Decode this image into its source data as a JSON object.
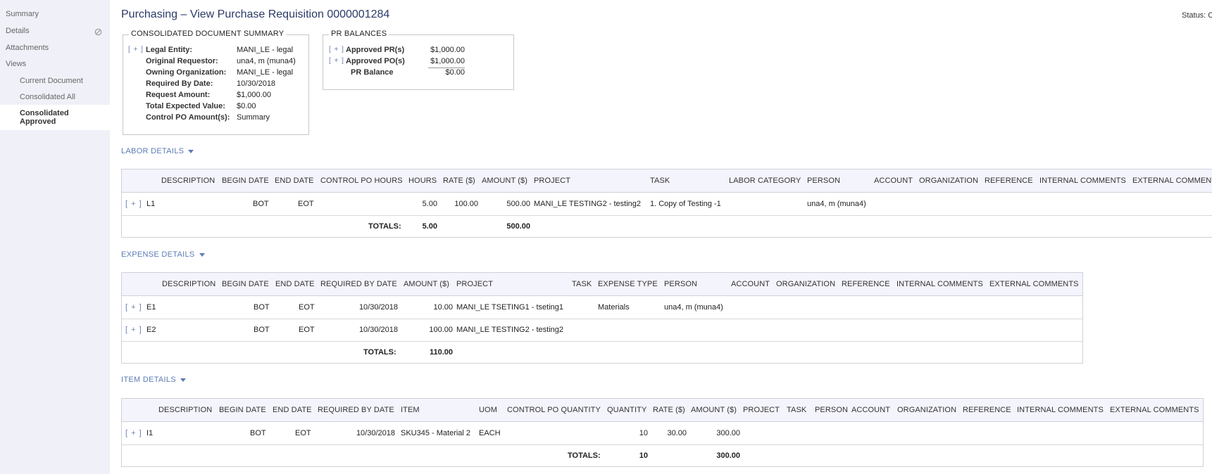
{
  "sidebar": {
    "summary": "Summary",
    "details": "Details",
    "attachments": "Attachments",
    "views": "Views",
    "current_document": "Current Document",
    "consolidated_all": "Consolidated All",
    "consolidated_approved": "Consolidated Approved"
  },
  "header": {
    "title": "Purchasing – View Purchase Requisition 0000001284",
    "status": "Status: C"
  },
  "plus": "[ + ]",
  "summary_box": {
    "legend": "CONSOLIDATED DOCUMENT SUMMARY",
    "rows": [
      {
        "label": "Legal Entity:",
        "value": "MANI_LE - legal"
      },
      {
        "label": "Original Requestor:",
        "value": "una4, m (muna4)"
      },
      {
        "label": "Owning Organization:",
        "value": "MANI_LE - legal"
      },
      {
        "label": "Required By Date:",
        "value": "10/30/2018"
      },
      {
        "label": "Request Amount:",
        "value": "$1,000.00"
      },
      {
        "label": "Total Expected Value:",
        "value": "$0.00"
      },
      {
        "label": "Control PO Amount(s):",
        "value": "Summary"
      }
    ]
  },
  "pr_balances": {
    "legend": "PR BALANCES",
    "rows": [
      {
        "label": "Approved PR(s)",
        "value": "$1,000.00"
      },
      {
        "label": "Approved PO(s)",
        "value": "$1,000.00"
      },
      {
        "label": "PR Balance",
        "value": "$0.00"
      }
    ]
  },
  "labor": {
    "title": "LABOR DETAILS",
    "headers": [
      "DESCRIPTION",
      "BEGIN DATE",
      "END DATE",
      "CONTROL PO HOURS",
      "HOURS",
      "RATE ($)",
      "AMOUNT ($)",
      "PROJECT",
      "TASK",
      "LABOR CATEGORY",
      "PERSON",
      "ACCOUNT",
      "ORGANIZATION",
      "REFERENCE",
      "INTERNAL COMMENTS",
      "EXTERNAL COMMENTS"
    ],
    "row": {
      "description": "L1",
      "begin": "BOT",
      "end": "EOT",
      "hours": "5.00",
      "rate": "100.00",
      "amount": "500.00",
      "project": "MANI_LE TESTING2 - testing2",
      "task": "1. Copy of Testing -1",
      "person": "una4, m (muna4)"
    },
    "totals": {
      "label": "TOTALS:",
      "hours": "5.00",
      "amount": "500.00"
    }
  },
  "expense": {
    "title": "EXPENSE DETAILS",
    "headers": [
      "DESCRIPTION",
      "BEGIN DATE",
      "END DATE",
      "REQUIRED BY DATE",
      "AMOUNT ($)",
      "PROJECT",
      "TASK",
      "EXPENSE TYPE",
      "PERSON",
      "ACCOUNT",
      "ORGANIZATION",
      "REFERENCE",
      "INTERNAL COMMENTS",
      "EXTERNAL COMMENTS"
    ],
    "rows": [
      {
        "description": "E1",
        "begin": "BOT",
        "end": "EOT",
        "required": "10/30/2018",
        "amount": "10.00",
        "project": "MANI_LE TSETING1 - tseting1",
        "type": "Materials",
        "person": "una4, m (muna4)"
      },
      {
        "description": "E2",
        "begin": "BOT",
        "end": "EOT",
        "required": "10/30/2018",
        "amount": "100.00",
        "project": "MANI_LE TESTING2 - testing2",
        "type": "",
        "person": ""
      }
    ],
    "totals": {
      "label": "TOTALS:",
      "amount": "110.00"
    }
  },
  "item": {
    "title": "ITEM DETAILS",
    "headers": [
      "DESCRIPTION",
      "BEGIN DATE",
      "END DATE",
      "REQUIRED BY DATE",
      "ITEM",
      "UOM",
      "CONTROL PO QUANTITY",
      "QUANTITY",
      "RATE ($)",
      "AMOUNT ($)",
      "PROJECT",
      "TASK",
      "PERSON",
      "ACCOUNT",
      "ORGANIZATION",
      "REFERENCE",
      "INTERNAL COMMENTS",
      "EXTERNAL COMMENTS"
    ],
    "row": {
      "description": "I1",
      "begin": "BOT",
      "end": "EOT",
      "required": "10/30/2018",
      "item": "SKU345 - Material 2",
      "uom": "EACH",
      "quantity": "10",
      "rate": "30.00",
      "amount": "300.00"
    },
    "totals": {
      "label": "TOTALS:",
      "quantity": "10",
      "amount": "300.00"
    }
  }
}
